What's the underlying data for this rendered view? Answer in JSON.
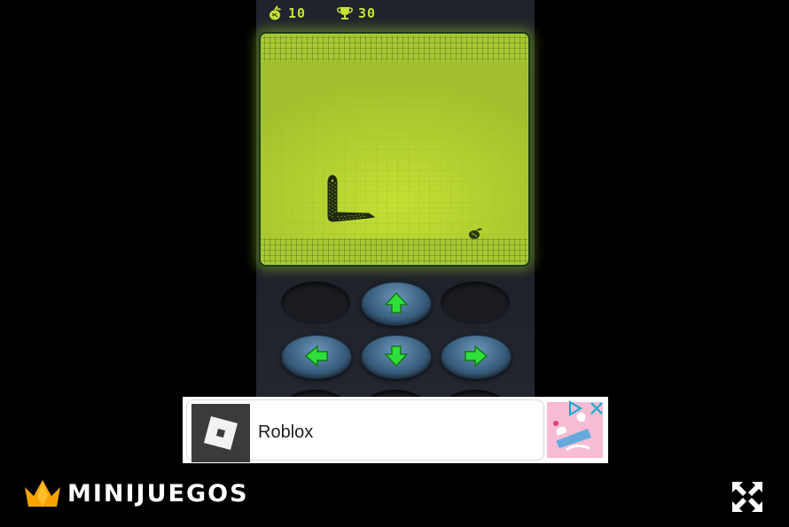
{
  "hud": {
    "food_icon": "apple-icon",
    "score": "10",
    "trophy_icon": "trophy-icon",
    "best": "30"
  },
  "game": {
    "screen_color": "#a8c832",
    "snake_direction": "right",
    "controls": [
      "up",
      "left",
      "down",
      "right"
    ],
    "accent_color": "#2ee03a"
  },
  "ad": {
    "title": "Roblox",
    "logo_icon": "roblox-logo",
    "choices_icon": "adchoices-icon",
    "close_icon": "close-icon"
  },
  "footer": {
    "brand": "MINIJUEGOS",
    "crown_icon": "crown-icon",
    "fullscreen_icon": "fullscreen-icon"
  }
}
